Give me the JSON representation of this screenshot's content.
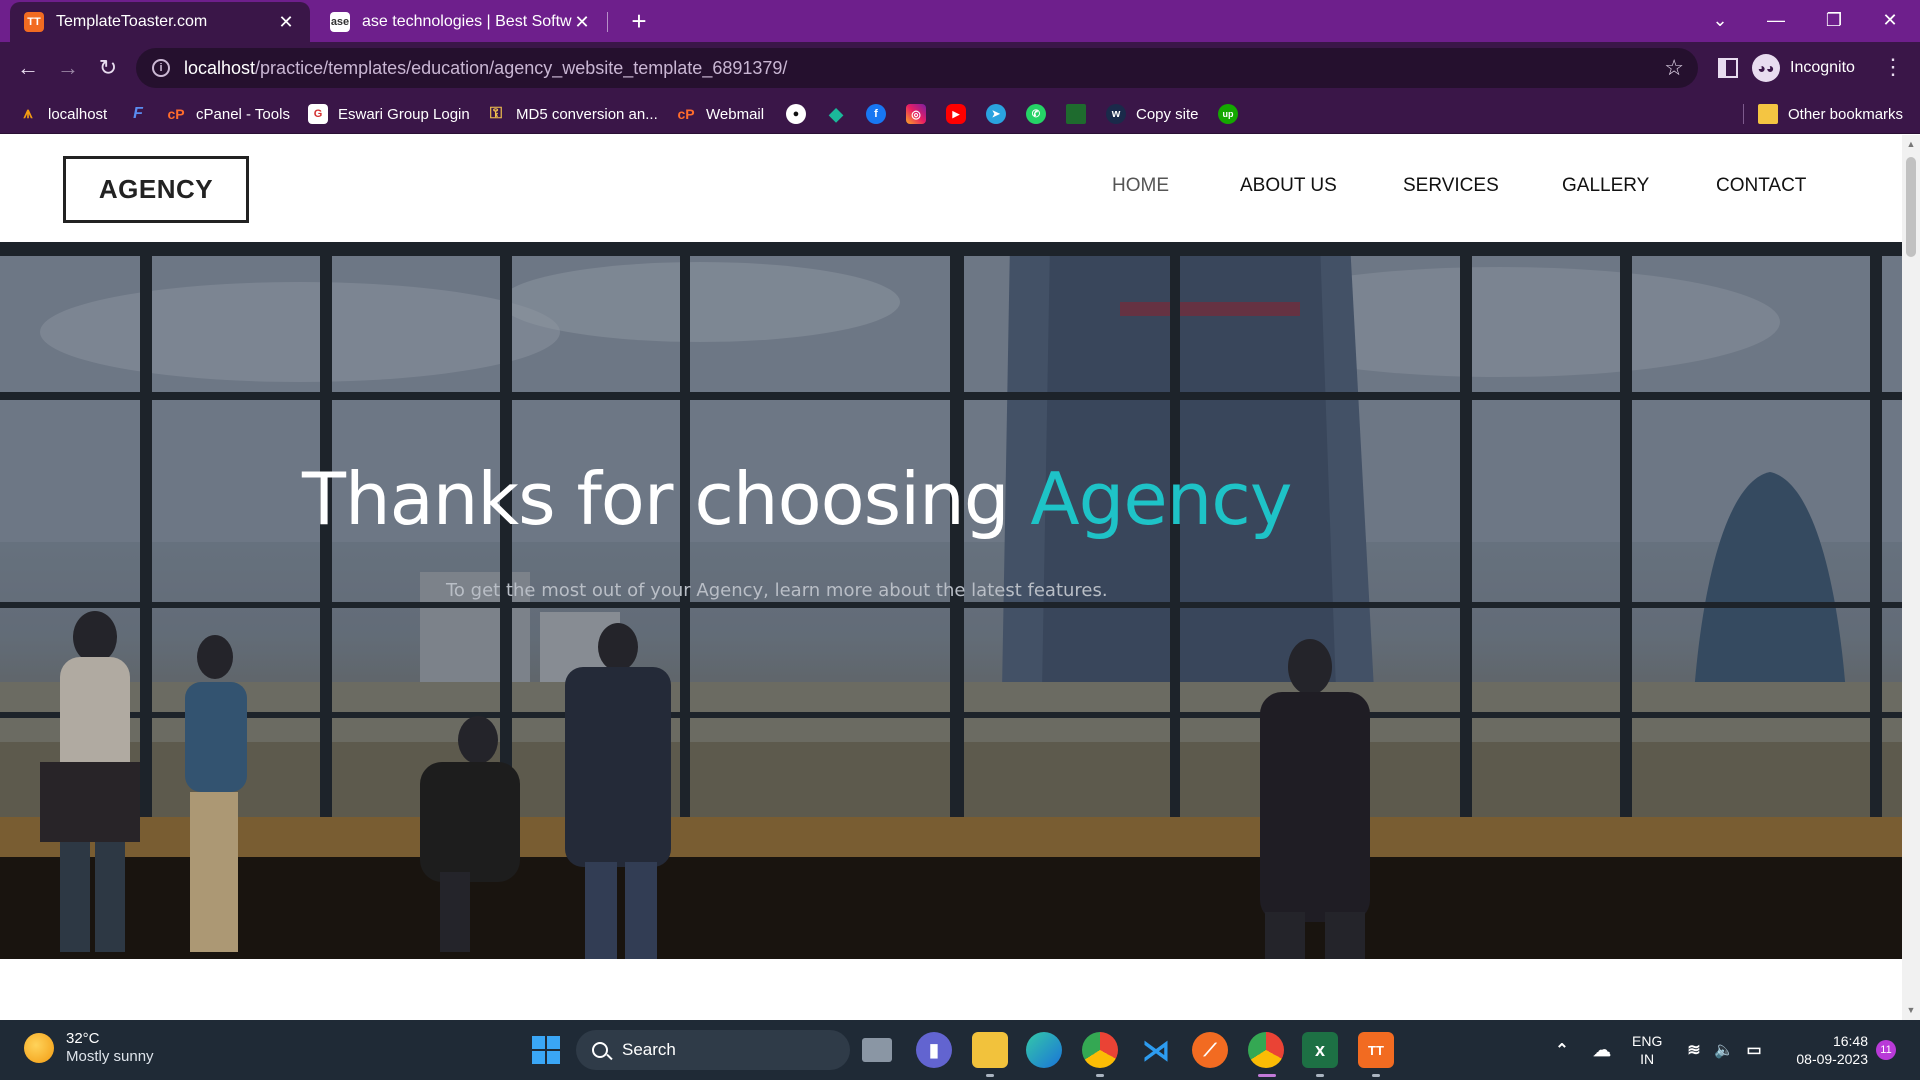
{
  "browser": {
    "tabs": [
      {
        "title": "TemplateToaster.com",
        "favicon": "templatetoaster-icon",
        "active": true
      },
      {
        "title": "ase technologies | Best Software",
        "favicon": "ase-icon",
        "active": false
      }
    ],
    "new_tab": "+",
    "url_host": "localhost",
    "url_path": "/practice/templates/education/agency_website_template_6891379/",
    "profile_label": "Incognito",
    "bookmarks": [
      {
        "label": "localhost",
        "icon": "xampp-icon"
      },
      {
        "label": "",
        "icon": "fontawesome-icon"
      },
      {
        "label": "cPanel - Tools",
        "icon": "cpanel-icon"
      },
      {
        "label": "Eswari Group Login",
        "icon": "eswari-icon"
      },
      {
        "label": "MD5 conversion an...",
        "icon": "key-icon"
      },
      {
        "label": "Webmail",
        "icon": "cpanel-icon"
      },
      {
        "label": "",
        "icon": "github-icon"
      },
      {
        "label": "",
        "icon": "diamond-icon"
      },
      {
        "label": "",
        "icon": "facebook-icon"
      },
      {
        "label": "",
        "icon": "instagram-icon"
      },
      {
        "label": "",
        "icon": "youtube-icon"
      },
      {
        "label": "",
        "icon": "telegram-icon"
      },
      {
        "label": "",
        "icon": "whatsapp-icon"
      },
      {
        "label": "",
        "icon": "sheet-icon"
      },
      {
        "label": "Copy site",
        "icon": "copysite-icon"
      },
      {
        "label": "",
        "icon": "upwork-icon"
      }
    ],
    "other_bookmarks": "Other bookmarks"
  },
  "site": {
    "logo": "AGENCY",
    "nav": [
      "HOME",
      "ABOUT US",
      "SERVICES",
      "GALLERY",
      "CONTACT"
    ],
    "active_nav": "HOME",
    "hero_title_main": "Thanks for choosing ",
    "hero_title_accent": "Agency",
    "hero_subtitle": "To get the most out of your Agency, learn more about the latest features.",
    "accent_color": "#1ec3c7"
  },
  "taskbar": {
    "temperature": "32°C",
    "weather": "Mostly sunny",
    "search_placeholder": "Search",
    "lang_top": "ENG",
    "lang_bottom": "IN",
    "time": "16:48",
    "date": "08-09-2023",
    "notifications": "11"
  }
}
